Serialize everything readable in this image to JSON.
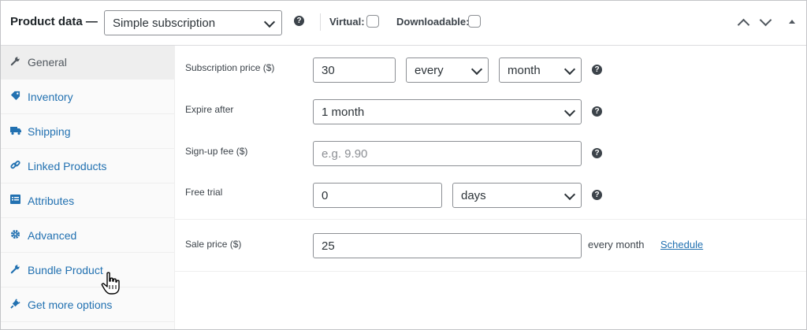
{
  "header": {
    "title": "Product data —",
    "product_type": {
      "selected": "Simple subscription"
    },
    "virtual_label": "Virtual:",
    "downloadable_label": "Downloadable:",
    "virtual_checked": false,
    "downloadable_checked": false
  },
  "sidebar": {
    "items": [
      {
        "label": "General",
        "icon": "wrench-icon",
        "active": true
      },
      {
        "label": "Inventory",
        "icon": "tag-icon",
        "active": false
      },
      {
        "label": "Shipping",
        "icon": "truck-icon",
        "active": false
      },
      {
        "label": "Linked Products",
        "icon": "link-icon",
        "active": false
      },
      {
        "label": "Attributes",
        "icon": "list-icon",
        "active": false
      },
      {
        "label": "Advanced",
        "icon": "gear-icon",
        "active": false
      },
      {
        "label": "Bundle Product",
        "icon": "wrench-icon",
        "active": false
      },
      {
        "label": "Get more options",
        "icon": "plugin-icon",
        "active": false
      }
    ]
  },
  "general": {
    "subscription_price": {
      "label": "Subscription price ($)",
      "value": "30",
      "interval": "every",
      "period": "month"
    },
    "expire_after": {
      "label": "Expire after",
      "value": "1 month"
    },
    "signup_fee": {
      "label": "Sign-up fee ($)",
      "placeholder": "e.g. 9.90"
    },
    "free_trial": {
      "label": "Free trial",
      "value": "0",
      "unit": "days"
    },
    "sale_price": {
      "label": "Sale price ($)",
      "value": "25",
      "suffix": "every month",
      "schedule_link": "Schedule"
    }
  },
  "colors": {
    "link": "#2271b1",
    "border": "#8c8f94",
    "active_tab_bg": "#eeeeee",
    "sidebar_bg": "#fafafa"
  }
}
